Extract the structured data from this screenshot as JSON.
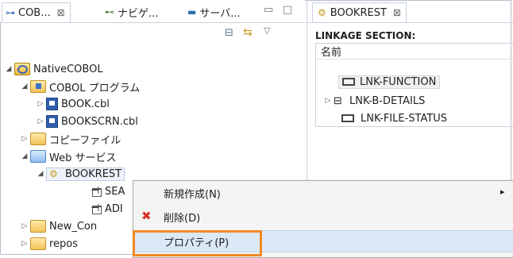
{
  "left": {
    "tabs": [
      {
        "label": "COB...",
        "close": "⊠"
      },
      {
        "label": "ナビゲ..."
      },
      {
        "label": "サーバ..."
      }
    ],
    "tree": [
      {
        "label": "NativeCOBOL"
      },
      {
        "label": "COBOL プログラム"
      },
      {
        "label": "BOOK.cbl"
      },
      {
        "label": "BOOKSCRN.cbl"
      },
      {
        "label": "コピーファイル"
      },
      {
        "label": "Web サービス"
      },
      {
        "label": "BOOKREST"
      },
      {
        "label": "SEA"
      },
      {
        "label": "ADI"
      },
      {
        "label": "New_Con"
      },
      {
        "label": "repos"
      }
    ]
  },
  "right": {
    "tab": {
      "label": "BOOKREST",
      "close": "⊠"
    },
    "section_title": "LINKAGE SECTION:",
    "column_header": "名前",
    "rows": [
      {
        "label": "LNK-FUNCTION"
      },
      {
        "label": "LNK-B-DETAILS"
      },
      {
        "label": "LNK-FILE-STATUS"
      }
    ]
  },
  "context_menu": {
    "items": [
      {
        "label": "新規作成(N)",
        "submenu": "▸"
      },
      {
        "label": "削除(D)",
        "icon": "✖"
      },
      {
        "label": "プロパティ(P)"
      }
    ]
  }
}
